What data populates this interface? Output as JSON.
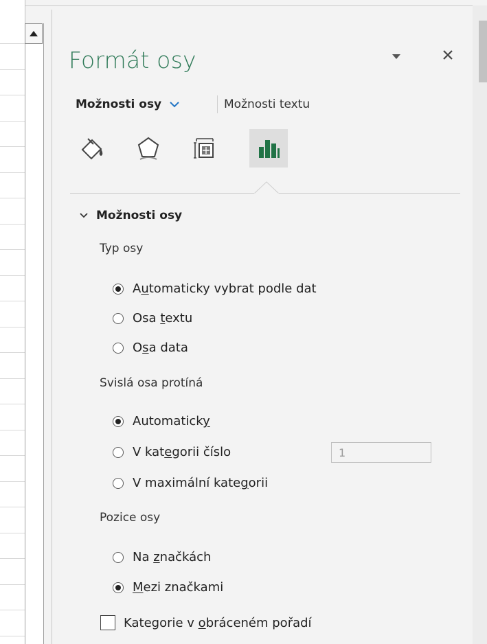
{
  "pane": {
    "title": "Formát osy",
    "tabs": {
      "axis_options": "Možnosti osy",
      "text_options": "Možnosti textu"
    },
    "icons": [
      "fill-line-icon",
      "effects-icon",
      "size-properties-icon",
      "axis-options-icon"
    ],
    "active_icon": "axis-options-icon",
    "accent_color": "#217346"
  },
  "section": {
    "title": "Možnosti osy",
    "axis_type": {
      "label": "Typ osy",
      "options": [
        {
          "pre": "A",
          "u": "u",
          "post": "tomaticky vybrat podle dat",
          "checked": true
        },
        {
          "pre": "Osa ",
          "u": "t",
          "post": "extu",
          "checked": false
        },
        {
          "pre": "O",
          "u": "s",
          "post": "a data",
          "checked": false
        }
      ]
    },
    "vertical_crosses": {
      "label": "Svislá osa protíná",
      "options": [
        {
          "pre": "Automatick",
          "u": "y",
          "post": "",
          "checked": true
        },
        {
          "pre": "V kat",
          "u": "e",
          "post": "gorii číslo",
          "checked": false
        },
        {
          "pre": "V maximální kate",
          "u": "g",
          "post": "orii",
          "checked": false
        }
      ],
      "category_number_value": "1"
    },
    "axis_position": {
      "label": "Pozice osy",
      "options": [
        {
          "pre": "Na ",
          "u": "z",
          "post": "načkách",
          "checked": false
        },
        {
          "pre": "",
          "u": "M",
          "post": "ezi značkami",
          "checked": true
        }
      ]
    },
    "reverse_order": {
      "pre": "Kategorie v ",
      "u": "o",
      "post": "bráceném pořadí",
      "checked": false
    }
  }
}
